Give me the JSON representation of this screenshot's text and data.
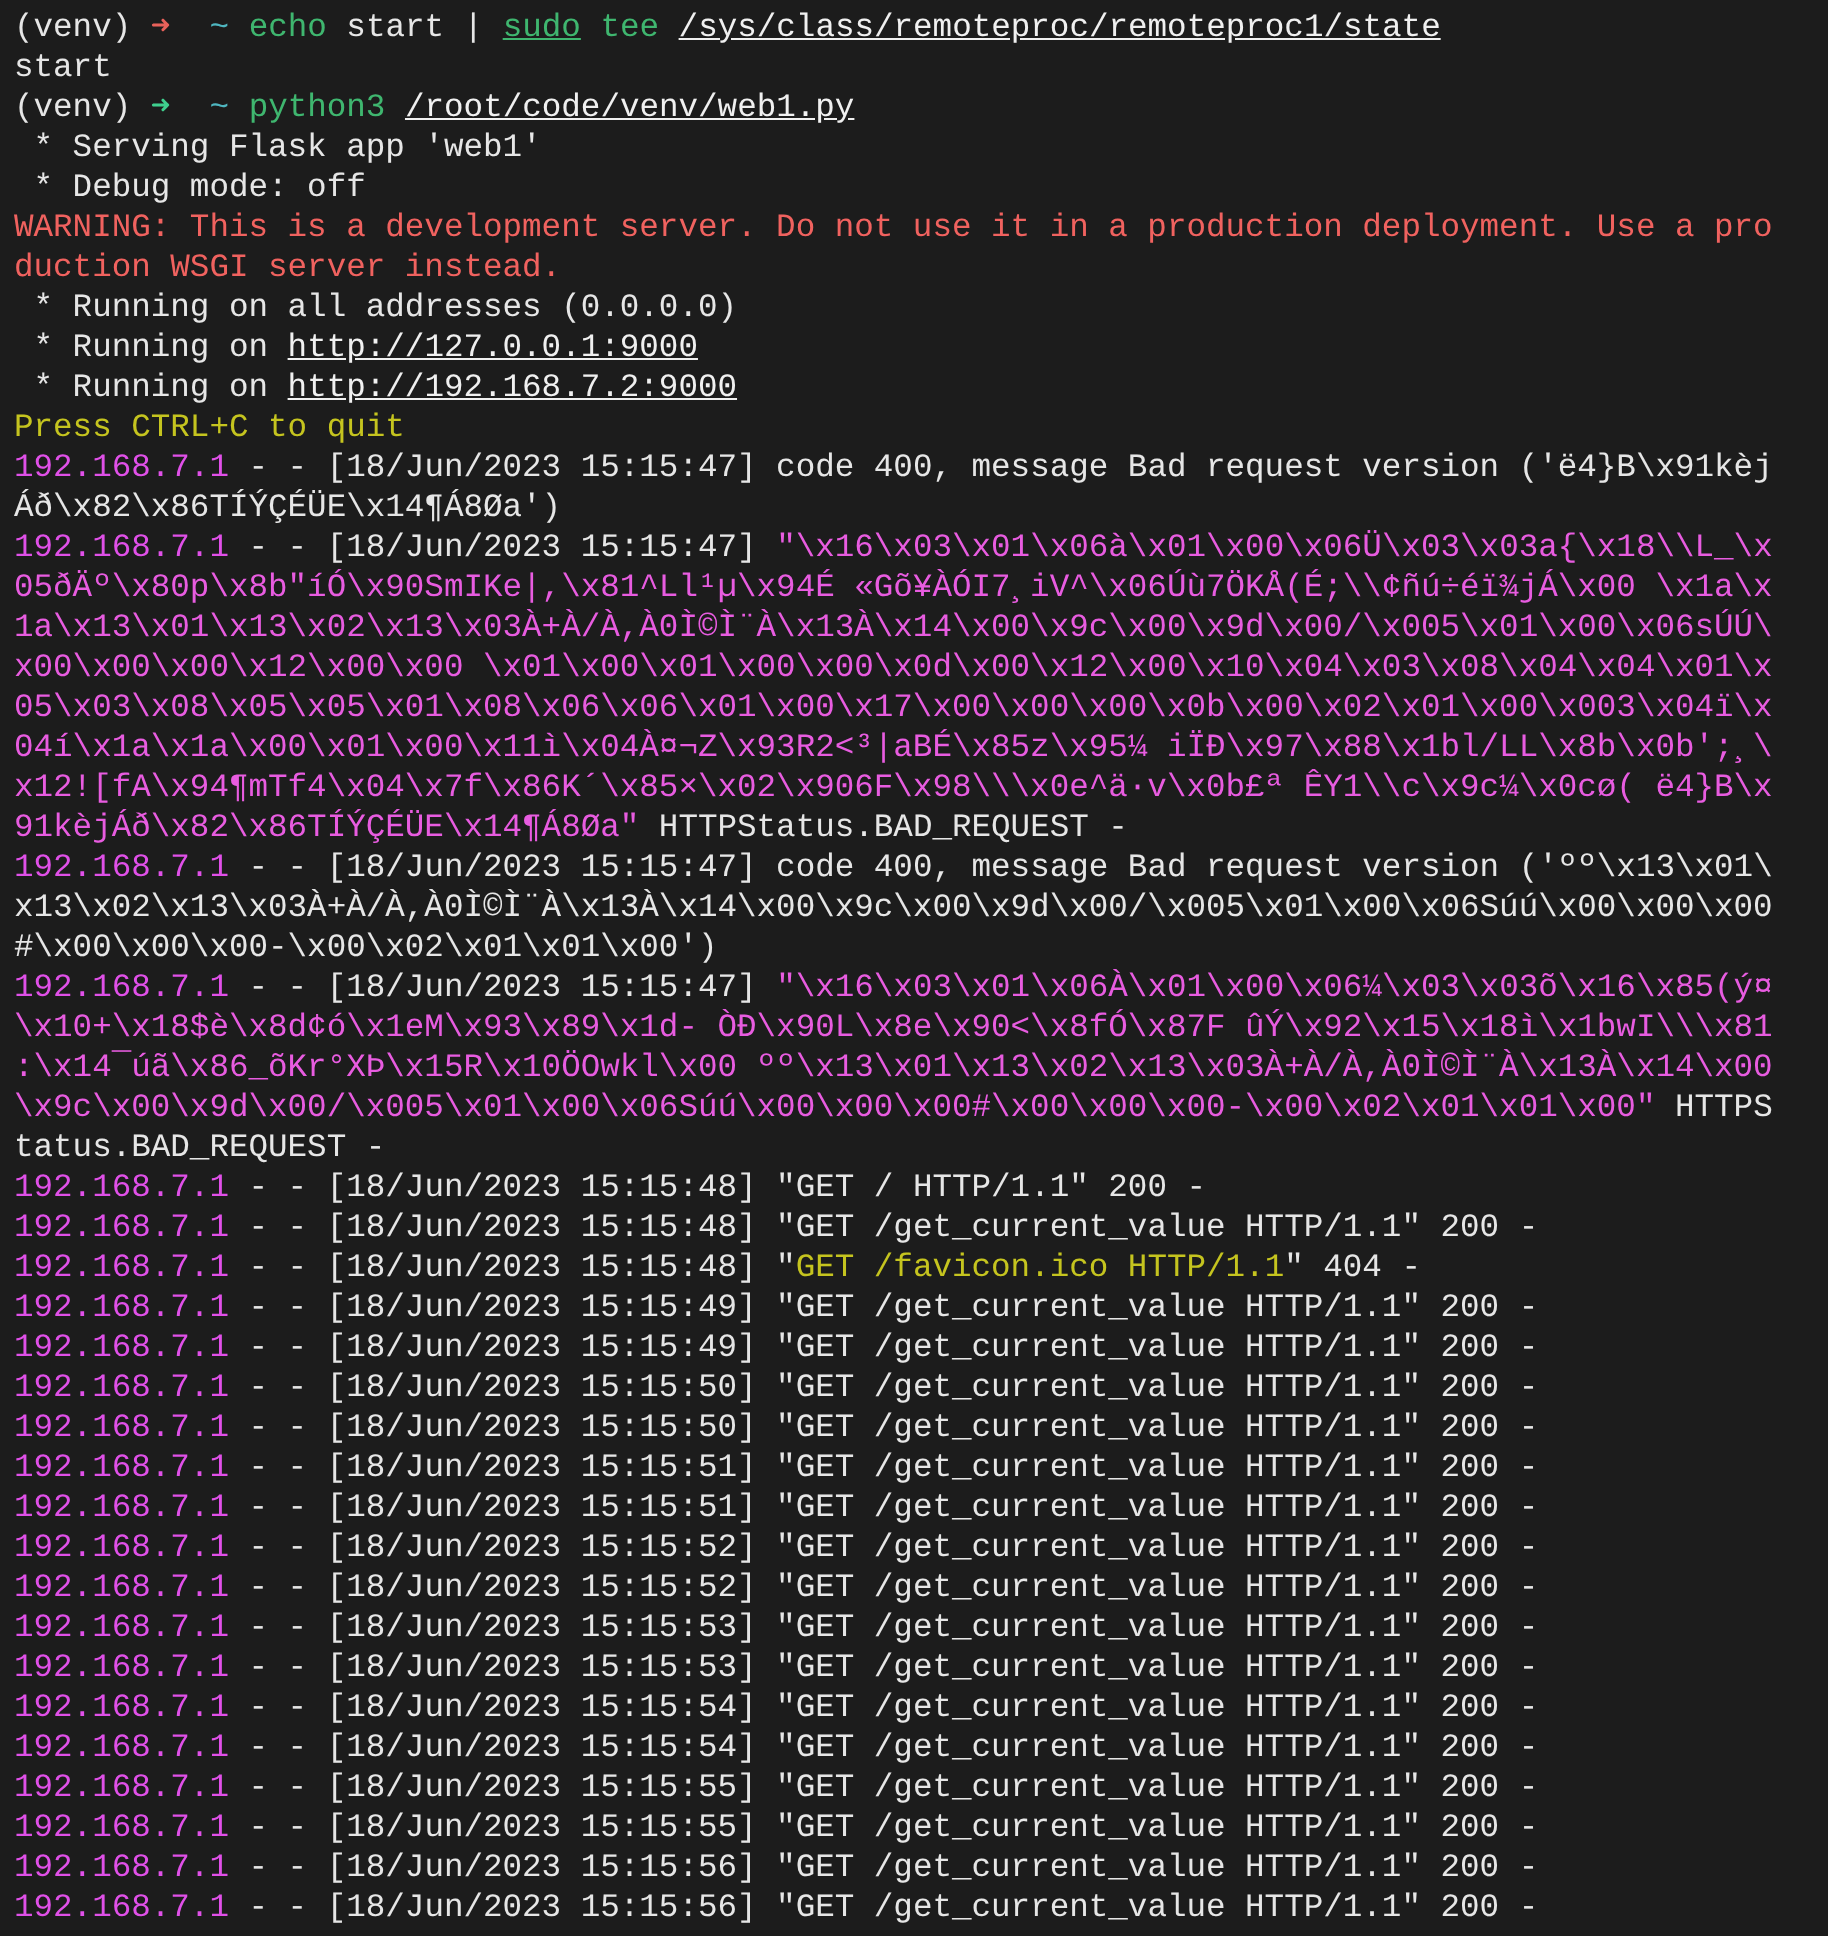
{
  "terminal": {
    "lines": [
      {
        "segments": [
          {
            "text": "(venv) ",
            "kind": "plain"
          },
          {
            "text": "➜",
            "kind": "arrow_error"
          },
          {
            "text": "  ~ ",
            "kind": "cwd"
          },
          {
            "text": "echo",
            "kind": "command"
          },
          {
            "text": " start | ",
            "kind": "plain"
          },
          {
            "text": "sudo",
            "kind": "command_link"
          },
          {
            "text": " tee ",
            "kind": "command"
          },
          {
            "text": "/sys/class/remoteproc/remoteproc1/state",
            "kind": "path"
          }
        ]
      },
      {
        "segments": [
          {
            "text": "start",
            "kind": "plain"
          }
        ]
      },
      {
        "segments": [
          {
            "text": "(venv) ",
            "kind": "plain"
          },
          {
            "text": "➜",
            "kind": "arrow_ok"
          },
          {
            "text": "  ~ ",
            "kind": "cwd"
          },
          {
            "text": "python3 ",
            "kind": "command"
          },
          {
            "text": "/root/code/venv/web1.py",
            "kind": "path"
          }
        ]
      },
      {
        "segments": [
          {
            "text": " * Serving Flask app 'web1'",
            "kind": "plain"
          }
        ]
      },
      {
        "segments": [
          {
            "text": " * Debug mode: off",
            "kind": "plain"
          }
        ]
      },
      {
        "segments": [
          {
            "text": "WARNING: This is a development server. Do not use it in a production deployment. Use a pro",
            "kind": "warning"
          }
        ]
      },
      {
        "segments": [
          {
            "text": "duction WSGI server instead.",
            "kind": "warning"
          }
        ]
      },
      {
        "segments": [
          {
            "text": " * Running on all addresses (0.0.0.0)",
            "kind": "plain"
          }
        ]
      },
      {
        "segments": [
          {
            "text": " * Running on ",
            "kind": "plain"
          },
          {
            "text": "http://127.0.0.1:9000",
            "kind": "link"
          }
        ]
      },
      {
        "segments": [
          {
            "text": " * Running on ",
            "kind": "plain"
          },
          {
            "text": "http://192.168.7.2:9000",
            "kind": "link"
          }
        ]
      },
      {
        "segments": [
          {
            "text": "Press CTRL+C to quit",
            "kind": "notice"
          }
        ]
      },
      {
        "segments": [
          {
            "text": "192.168.7.1",
            "kind": "ip"
          },
          {
            "text": " - - [18/Jun/2023 15:15:47] code 400, message Bad request version ('ë4}B\\x91kèj",
            "kind": "plain"
          }
        ]
      },
      {
        "segments": [
          {
            "text": "Áð\\x82\\x86TÍÝÇÉÜE\\x14¶Á8Øa')",
            "kind": "plain"
          }
        ]
      },
      {
        "segments": [
          {
            "text": "192.168.7.1",
            "kind": "ip"
          },
          {
            "text": " - - [18/Jun/2023 15:15:47] ",
            "kind": "plain"
          },
          {
            "text": "\"\\x16\\x03\\x01\\x06à\\x01\\x00\\x06Ü\\x03\\x03a{\\x18\\\\L_\\x",
            "kind": "payload"
          }
        ]
      },
      {
        "segments": [
          {
            "text": "05ðÄº\\x80p\\x8b\"íÓ\\x90SmIKe|,\\x81^Ll¹µ\\x94É «Gõ¥ÀÓI7¸iV^\\x06Úù7ÖKÅ(É;\\\\¢ñú÷éï¾jÁ\\x00 \\x1a\\x",
            "kind": "payload"
          }
        ]
      },
      {
        "segments": [
          {
            "text": "1a\\x13\\x01\\x13\\x02\\x13\\x03À+À/À,À0Ì©Ì¨À\\x13À\\x14\\x00\\x9c\\x00\\x9d\\x00/\\x005\\x01\\x00\\x06sÚÚ\\",
            "kind": "payload"
          }
        ]
      },
      {
        "segments": [
          {
            "text": "x00\\x00\\x00\\x12\\x00\\x00 \\x01\\x00\\x01\\x00\\x00\\x0d\\x00\\x12\\x00\\x10\\x04\\x03\\x08\\x04\\x04\\x01\\x",
            "kind": "payload"
          }
        ]
      },
      {
        "segments": [
          {
            "text": "05\\x03\\x08\\x05\\x05\\x01\\x08\\x06\\x06\\x01\\x00\\x17\\x00\\x00\\x00\\x0b\\x00\\x02\\x01\\x00\\x003\\x04ï\\x",
            "kind": "payload"
          }
        ]
      },
      {
        "segments": [
          {
            "text": "04í\\x1a\\x1a\\x00\\x01\\x00\\x11ì\\x04À¤¬Z\\x93R2<³|aBÉ\\x85z\\x95¼ iÏÐ\\x97\\x88\\x1bl/LL\\x8b\\x0b';¸\\",
            "kind": "payload"
          }
        ]
      },
      {
        "segments": [
          {
            "text": "x12![fA\\x94¶mTf4\\x04\\x7f\\x86K´\\x85×\\x02\\x906F\\x98\\\\\\x0e^ä·v\\x0b£ª ÊY1\\\\c\\x9c¼\\x0cø( ë4}B\\x",
            "kind": "payload"
          }
        ]
      },
      {
        "segments": [
          {
            "text": "91kèjÁð\\x82\\x86TÍÝÇÉÜE\\x14¶Á8Øa\"",
            "kind": "payload"
          },
          {
            "text": " HTTPStatus.BAD_REQUEST -",
            "kind": "plain"
          }
        ]
      },
      {
        "segments": [
          {
            "text": "192.168.7.1",
            "kind": "ip"
          },
          {
            "text": " - - [18/Jun/2023 15:15:47] code 400, message Bad request version ('ºº\\x13\\x01\\",
            "kind": "plain"
          }
        ]
      },
      {
        "segments": [
          {
            "text": "x13\\x02\\x13\\x03À+À/À,À0Ì©Ì¨À\\x13À\\x14\\x00\\x9c\\x00\\x9d\\x00/\\x005\\x01\\x00\\x06Súú\\x00\\x00\\x00",
            "kind": "plain"
          }
        ]
      },
      {
        "segments": [
          {
            "text": "#\\x00\\x00\\x00-\\x00\\x02\\x01\\x01\\x00')",
            "kind": "plain"
          }
        ]
      },
      {
        "segments": [
          {
            "text": "192.168.7.1",
            "kind": "ip"
          },
          {
            "text": " - - [18/Jun/2023 15:15:47] ",
            "kind": "plain"
          },
          {
            "text": "\"\\x16\\x03\\x01\\x06À\\x01\\x00\\x06¼\\x03\\x03õ\\x16\\x85(ý¤",
            "kind": "payload"
          }
        ]
      },
      {
        "segments": [
          {
            "text": "\\x10+\\x18$è\\x8d¢ó\\x1eM\\x93\\x89\\x1d- ÒÐ\\x90L\\x8e\\x90<\\x8fÓ\\x87F ûÝ\\x92\\x15\\x18ì\\x1bwI\\\\\\x81",
            "kind": "payload"
          }
        ]
      },
      {
        "segments": [
          {
            "text": ":\\x14¯úã\\x86_õKr°XÞ\\x15R\\x10ÖOwkl\\x00 ºº\\x13\\x01\\x13\\x02\\x13\\x03À+À/À,À0Ì©Ì¨À\\x13À\\x14\\x00",
            "kind": "payload"
          }
        ]
      },
      {
        "segments": [
          {
            "text": "\\x9c\\x00\\x9d\\x00/\\x005\\x01\\x00\\x06Súú\\x00\\x00\\x00#\\x00\\x00\\x00-\\x00\\x02\\x01\\x01\\x00\"",
            "kind": "payload"
          },
          {
            "text": " HTTPS",
            "kind": "plain"
          }
        ]
      },
      {
        "segments": [
          {
            "text": "tatus.BAD_REQUEST -",
            "kind": "plain"
          }
        ]
      },
      {
        "segments": [
          {
            "text": "192.168.7.1",
            "kind": "ip"
          },
          {
            "text": " - - [18/Jun/2023 15:15:48] \"GET / HTTP/1.1\" 200 -",
            "kind": "plain"
          }
        ]
      },
      {
        "segments": [
          {
            "text": "192.168.7.1",
            "kind": "ip"
          },
          {
            "text": " - - [18/Jun/2023 15:15:48] \"GET /get_current_value HTTP/1.1\" 200 -",
            "kind": "plain"
          }
        ]
      },
      {
        "segments": [
          {
            "text": "192.168.7.1",
            "kind": "ip"
          },
          {
            "text": " - - [18/Jun/2023 15:15:48] \"",
            "kind": "plain"
          },
          {
            "text": "GET /favicon.ico HTTP/1.1",
            "kind": "notice"
          },
          {
            "text": "\" 404 -",
            "kind": "plain"
          }
        ]
      },
      {
        "segments": [
          {
            "text": "192.168.7.1",
            "kind": "ip"
          },
          {
            "text": " - - [18/Jun/2023 15:15:49] \"GET /get_current_value HTTP/1.1\" 200 -",
            "kind": "plain"
          }
        ]
      },
      {
        "segments": [
          {
            "text": "192.168.7.1",
            "kind": "ip"
          },
          {
            "text": " - - [18/Jun/2023 15:15:49] \"GET /get_current_value HTTP/1.1\" 200 -",
            "kind": "plain"
          }
        ]
      },
      {
        "segments": [
          {
            "text": "192.168.7.1",
            "kind": "ip"
          },
          {
            "text": " - - [18/Jun/2023 15:15:50] \"GET /get_current_value HTTP/1.1\" 200 -",
            "kind": "plain"
          }
        ]
      },
      {
        "segments": [
          {
            "text": "192.168.7.1",
            "kind": "ip"
          },
          {
            "text": " - - [18/Jun/2023 15:15:50] \"GET /get_current_value HTTP/1.1\" 200 -",
            "kind": "plain"
          }
        ]
      },
      {
        "segments": [
          {
            "text": "192.168.7.1",
            "kind": "ip"
          },
          {
            "text": " - - [18/Jun/2023 15:15:51] \"GET /get_current_value HTTP/1.1\" 200 -",
            "kind": "plain"
          }
        ]
      },
      {
        "segments": [
          {
            "text": "192.168.7.1",
            "kind": "ip"
          },
          {
            "text": " - - [18/Jun/2023 15:15:51] \"GET /get_current_value HTTP/1.1\" 200 -",
            "kind": "plain"
          }
        ]
      },
      {
        "segments": [
          {
            "text": "192.168.7.1",
            "kind": "ip"
          },
          {
            "text": " - - [18/Jun/2023 15:15:52] \"GET /get_current_value HTTP/1.1\" 200 -",
            "kind": "plain"
          }
        ]
      },
      {
        "segments": [
          {
            "text": "192.168.7.1",
            "kind": "ip"
          },
          {
            "text": " - - [18/Jun/2023 15:15:52] \"GET /get_current_value HTTP/1.1\" 200 -",
            "kind": "plain"
          }
        ]
      },
      {
        "segments": [
          {
            "text": "192.168.7.1",
            "kind": "ip"
          },
          {
            "text": " - - [18/Jun/2023 15:15:53] \"GET /get_current_value HTTP/1.1\" 200 -",
            "kind": "plain"
          }
        ]
      },
      {
        "segments": [
          {
            "text": "192.168.7.1",
            "kind": "ip"
          },
          {
            "text": " - - [18/Jun/2023 15:15:53] \"GET /get_current_value HTTP/1.1\" 200 -",
            "kind": "plain"
          }
        ]
      },
      {
        "segments": [
          {
            "text": "192.168.7.1",
            "kind": "ip"
          },
          {
            "text": " - - [18/Jun/2023 15:15:54] \"GET /get_current_value HTTP/1.1\" 200 -",
            "kind": "plain"
          }
        ]
      },
      {
        "segments": [
          {
            "text": "192.168.7.1",
            "kind": "ip"
          },
          {
            "text": " - - [18/Jun/2023 15:15:54] \"GET /get_current_value HTTP/1.1\" 200 -",
            "kind": "plain"
          }
        ]
      },
      {
        "segments": [
          {
            "text": "192.168.7.1",
            "kind": "ip"
          },
          {
            "text": " - - [18/Jun/2023 15:15:55] \"GET /get_current_value HTTP/1.1\" 200 -",
            "kind": "plain"
          }
        ]
      },
      {
        "segments": [
          {
            "text": "192.168.7.1",
            "kind": "ip"
          },
          {
            "text": " - - [18/Jun/2023 15:15:55] \"GET /get_current_value HTTP/1.1\" 200 -",
            "kind": "plain"
          }
        ]
      },
      {
        "segments": [
          {
            "text": "192.168.7.1",
            "kind": "ip"
          },
          {
            "text": " - - [18/Jun/2023 15:15:56] \"GET /get_current_value HTTP/1.1\" 200 -",
            "kind": "plain"
          }
        ]
      },
      {
        "segments": [
          {
            "text": "192.168.7.1",
            "kind": "ip"
          },
          {
            "text": " - - [18/Jun/2023 15:15:56] \"GET /get_current_value HTTP/1.1\" 200 -",
            "kind": "plain"
          }
        ]
      }
    ]
  }
}
